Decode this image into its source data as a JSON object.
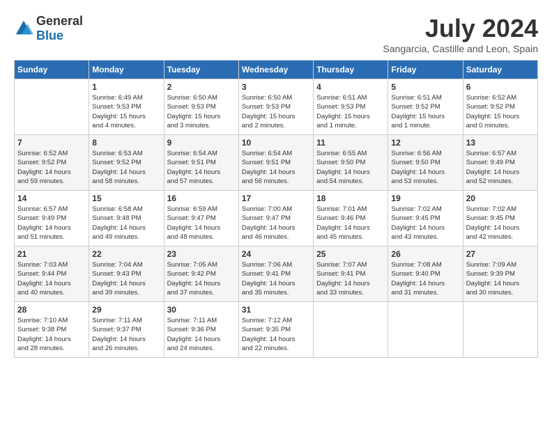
{
  "logo": {
    "general": "General",
    "blue": "Blue"
  },
  "title": "July 2024",
  "location": "Sangarcia, Castille and Leon, Spain",
  "weekdays": [
    "Sunday",
    "Monday",
    "Tuesday",
    "Wednesday",
    "Thursday",
    "Friday",
    "Saturday"
  ],
  "weeks": [
    [
      {
        "day": "",
        "content": ""
      },
      {
        "day": "1",
        "content": "Sunrise: 6:49 AM\nSunset: 9:53 PM\nDaylight: 15 hours\nand 4 minutes."
      },
      {
        "day": "2",
        "content": "Sunrise: 6:50 AM\nSunset: 9:53 PM\nDaylight: 15 hours\nand 3 minutes."
      },
      {
        "day": "3",
        "content": "Sunrise: 6:50 AM\nSunset: 9:53 PM\nDaylight: 15 hours\nand 2 minutes."
      },
      {
        "day": "4",
        "content": "Sunrise: 6:51 AM\nSunset: 9:53 PM\nDaylight: 15 hours\nand 1 minute."
      },
      {
        "day": "5",
        "content": "Sunrise: 6:51 AM\nSunset: 9:52 PM\nDaylight: 15 hours\nand 1 minute."
      },
      {
        "day": "6",
        "content": "Sunrise: 6:52 AM\nSunset: 9:52 PM\nDaylight: 15 hours\nand 0 minutes."
      }
    ],
    [
      {
        "day": "7",
        "content": "Sunrise: 6:52 AM\nSunset: 9:52 PM\nDaylight: 14 hours\nand 59 minutes."
      },
      {
        "day": "8",
        "content": "Sunrise: 6:53 AM\nSunset: 9:52 PM\nDaylight: 14 hours\nand 58 minutes."
      },
      {
        "day": "9",
        "content": "Sunrise: 6:54 AM\nSunset: 9:51 PM\nDaylight: 14 hours\nand 57 minutes."
      },
      {
        "day": "10",
        "content": "Sunrise: 6:54 AM\nSunset: 9:51 PM\nDaylight: 14 hours\nand 56 minutes."
      },
      {
        "day": "11",
        "content": "Sunrise: 6:55 AM\nSunset: 9:50 PM\nDaylight: 14 hours\nand 54 minutes."
      },
      {
        "day": "12",
        "content": "Sunrise: 6:56 AM\nSunset: 9:50 PM\nDaylight: 14 hours\nand 53 minutes."
      },
      {
        "day": "13",
        "content": "Sunrise: 6:57 AM\nSunset: 9:49 PM\nDaylight: 14 hours\nand 52 minutes."
      }
    ],
    [
      {
        "day": "14",
        "content": "Sunrise: 6:57 AM\nSunset: 9:49 PM\nDaylight: 14 hours\nand 51 minutes."
      },
      {
        "day": "15",
        "content": "Sunrise: 6:58 AM\nSunset: 9:48 PM\nDaylight: 14 hours\nand 49 minutes."
      },
      {
        "day": "16",
        "content": "Sunrise: 6:59 AM\nSunset: 9:47 PM\nDaylight: 14 hours\nand 48 minutes."
      },
      {
        "day": "17",
        "content": "Sunrise: 7:00 AM\nSunset: 9:47 PM\nDaylight: 14 hours\nand 46 minutes."
      },
      {
        "day": "18",
        "content": "Sunrise: 7:01 AM\nSunset: 9:46 PM\nDaylight: 14 hours\nand 45 minutes."
      },
      {
        "day": "19",
        "content": "Sunrise: 7:02 AM\nSunset: 9:45 PM\nDaylight: 14 hours\nand 43 minutes."
      },
      {
        "day": "20",
        "content": "Sunrise: 7:02 AM\nSunset: 9:45 PM\nDaylight: 14 hours\nand 42 minutes."
      }
    ],
    [
      {
        "day": "21",
        "content": "Sunrise: 7:03 AM\nSunset: 9:44 PM\nDaylight: 14 hours\nand 40 minutes."
      },
      {
        "day": "22",
        "content": "Sunrise: 7:04 AM\nSunset: 9:43 PM\nDaylight: 14 hours\nand 39 minutes."
      },
      {
        "day": "23",
        "content": "Sunrise: 7:05 AM\nSunset: 9:42 PM\nDaylight: 14 hours\nand 37 minutes."
      },
      {
        "day": "24",
        "content": "Sunrise: 7:06 AM\nSunset: 9:41 PM\nDaylight: 14 hours\nand 35 minutes."
      },
      {
        "day": "25",
        "content": "Sunrise: 7:07 AM\nSunset: 9:41 PM\nDaylight: 14 hours\nand 33 minutes."
      },
      {
        "day": "26",
        "content": "Sunrise: 7:08 AM\nSunset: 9:40 PM\nDaylight: 14 hours\nand 31 minutes."
      },
      {
        "day": "27",
        "content": "Sunrise: 7:09 AM\nSunset: 9:39 PM\nDaylight: 14 hours\nand 30 minutes."
      }
    ],
    [
      {
        "day": "28",
        "content": "Sunrise: 7:10 AM\nSunset: 9:38 PM\nDaylight: 14 hours\nand 28 minutes."
      },
      {
        "day": "29",
        "content": "Sunrise: 7:11 AM\nSunset: 9:37 PM\nDaylight: 14 hours\nand 26 minutes."
      },
      {
        "day": "30",
        "content": "Sunrise: 7:11 AM\nSunset: 9:36 PM\nDaylight: 14 hours\nand 24 minutes."
      },
      {
        "day": "31",
        "content": "Sunrise: 7:12 AM\nSunset: 9:35 PM\nDaylight: 14 hours\nand 22 minutes."
      },
      {
        "day": "",
        "content": ""
      },
      {
        "day": "",
        "content": ""
      },
      {
        "day": "",
        "content": ""
      }
    ]
  ]
}
